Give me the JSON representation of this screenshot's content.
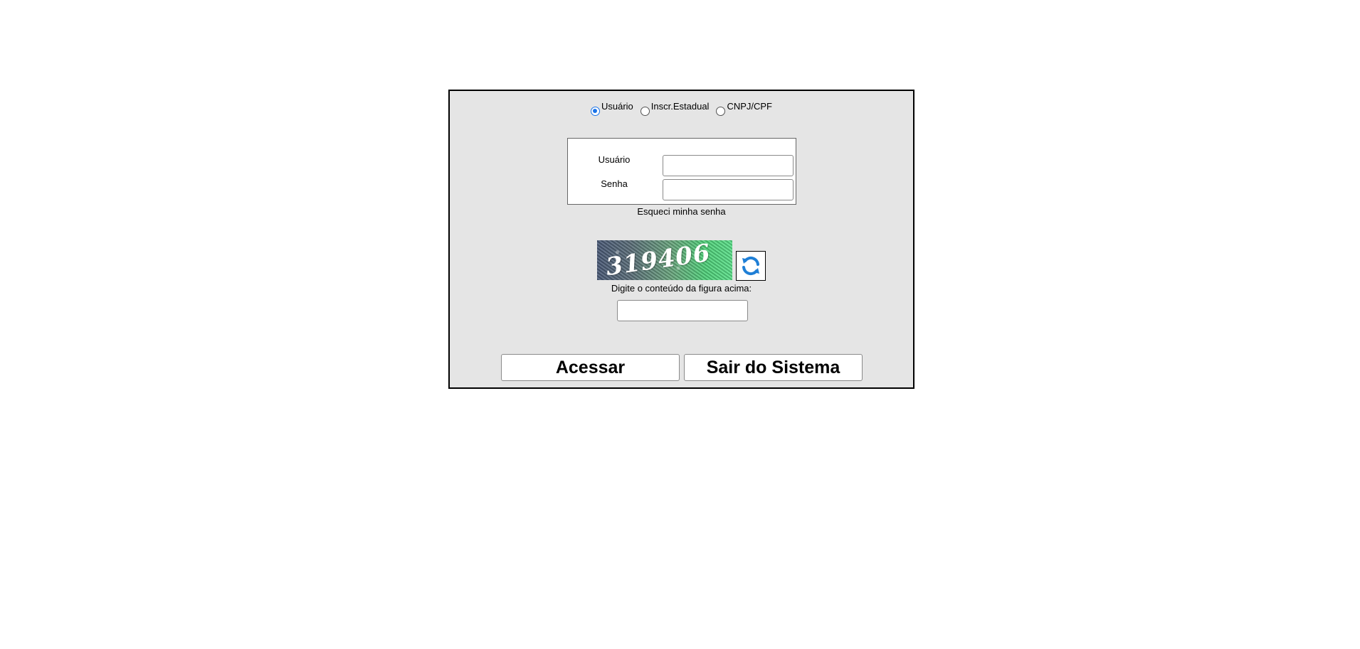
{
  "login_type": {
    "options": [
      {
        "label": "Usuário",
        "checked": true
      },
      {
        "label": "Inscr.Estadual",
        "checked": false
      },
      {
        "label": "CNPJ/CPF",
        "checked": false
      }
    ]
  },
  "login_form": {
    "user_label": "Usuário",
    "user_value": "",
    "password_label": "Senha",
    "password_value": ""
  },
  "forgot_password": "Esqueci minha senha",
  "captcha": {
    "image_text": "319406",
    "caption": "Digite o conteúdo da figura acima:",
    "input_value": ""
  },
  "actions": {
    "access_label": "Acessar",
    "exit_label": "Sair do Sistema"
  },
  "colors": {
    "panel_bg": "#e5e5e5",
    "radio_accent": "#1a73e8",
    "refresh_icon": "#1f7fd6"
  }
}
